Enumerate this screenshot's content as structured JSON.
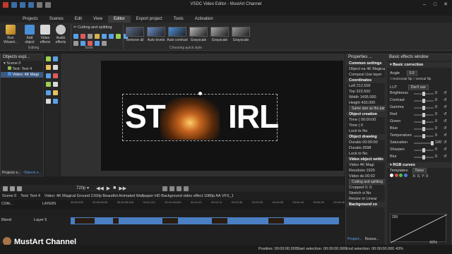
{
  "window": {
    "title": "VSDC Video Editor - MustArt Channel"
  },
  "menu": [
    "Projects",
    "Scenes",
    "Edit",
    "View",
    "Editor",
    "Export project",
    "Tools",
    "Activation"
  ],
  "menu_active_index": 4,
  "ribbon": {
    "run_wizard": "Run Wizard...",
    "add_object": "Add object",
    "video_effects": "Video effects",
    "audio_effects": "Audio effects",
    "editing_label": "Editing",
    "cutting": "Cutting and splitting",
    "tools_label": "Tools",
    "quick_styles": [
      "Remove all",
      "Auto levels",
      "Auto contrast",
      "Grayscale",
      "Grayscale",
      "Grayscale"
    ],
    "choosing_label": "Choosing quick style"
  },
  "explorer": {
    "title": "Objects expl...",
    "items": [
      "Scene 0",
      "Text: Text 4",
      "Video: 4K Magi"
    ],
    "tabs": [
      "Projects e...",
      "Objects e..."
    ]
  },
  "preview": {
    "text_left": "ST",
    "text_right": "IRL"
  },
  "properties": {
    "title": "Properties ...",
    "rows": [
      {
        "t": "Common settings",
        "s": true
      },
      {
        "t": "Object na 4K Magical",
        "s": false
      },
      {
        "t": "Composi Use layer",
        "s": false
      },
      {
        "t": "Coordinates",
        "s": true
      },
      {
        "t": "Left      212.500",
        "s": false
      },
      {
        "t": "Top       323.500",
        "s": false
      },
      {
        "t": "Width   1495.000",
        "s": false
      },
      {
        "t": "Height  433.000",
        "s": false
      },
      {
        "t": "Same size as the par",
        "s": false,
        "btn": true
      },
      {
        "t": "Object creation",
        "s": true
      },
      {
        "t": "Time ( 00:00:00",
        "s": false
      },
      {
        "t": "Time ( 0",
        "s": false
      },
      {
        "t": "Lock to No",
        "s": false
      },
      {
        "t": "Object drawing",
        "s": true
      },
      {
        "t": "Duratio 00:00:00",
        "s": false
      },
      {
        "t": "Duratio 3598",
        "s": false
      },
      {
        "t": "Lock to No",
        "s": false
      },
      {
        "t": "Video object settin",
        "s": true
      },
      {
        "t": "Video    4K Magi",
        "s": false
      },
      {
        "t": "Resolutio 1920",
        "s": false
      },
      {
        "t": "Video du 00:02",
        "s": false
      },
      {
        "t": "Cutting and splitting",
        "s": false,
        "btn": true
      },
      {
        "t": "Cropped  0; 0;",
        "s": false
      },
      {
        "t": "Stretch vi No",
        "s": false
      },
      {
        "t": "Resize m Linear",
        "s": false
      },
      {
        "t": "Background co",
        "s": true
      }
    ],
    "tabs": [
      "Propert...",
      "Resour..."
    ]
  },
  "effects": {
    "title": "Basic effects window",
    "section": "Basic correction",
    "angle_label": "Angle",
    "angle_value": "0.0",
    "h_flip": "Horizontal flip",
    "v_flip": "Vertical flip",
    "lut_label": "LUT",
    "lut_value": "Don't use",
    "sliders": [
      {
        "label": "Brightness",
        "value": "0"
      },
      {
        "label": "Contrast",
        "value": "0"
      },
      {
        "label": "Gamma",
        "value": "0"
      },
      {
        "label": "Red",
        "value": "0"
      },
      {
        "label": "Green",
        "value": "0"
      },
      {
        "label": "Blue",
        "value": "0"
      },
      {
        "label": "Temperature",
        "value": "0"
      },
      {
        "label": "Saturation",
        "value": "100"
      },
      {
        "label": "Sharpen",
        "value": "0"
      },
      {
        "label": "Blur",
        "value": "0"
      }
    ],
    "rgb_section": "RGB curves",
    "templates_label": "Templates:",
    "templates_value": "None",
    "curve_value": "255",
    "coords": "X: 0, Y: 0",
    "zoom": "43%"
  },
  "timeline": {
    "resolution": "720p",
    "breadcrumb": [
      "Scene 0",
      "Text: Text 4",
      "Video: 4K Magical Ground 2160p Beautiful Animated Wallpaper HD Background video effect 1080p AA VFX_1"
    ],
    "layers_header": "LAYERS",
    "com_label": "COM...",
    "blend_label": "Blend",
    "layer_label": "Layer 5",
    "ruler": [
      "00:00:000",
      "00:00:00:00",
      "00:00:35:400",
      "00:01:011",
      "00:01:06:600",
      "00:01:40",
      "00:02:11",
      "00:02:36",
      "00:03:33",
      "00:04:05",
      "00:04:40",
      "00:05:20",
      "00:05:36"
    ]
  },
  "status": {
    "position_label": "Position:",
    "position": "00:00:00.000",
    "start_label": "Start selection:",
    "start": "00:00:00.000",
    "end_label": "End selection:",
    "end": "00:00:00.000",
    "zoom": "43%"
  },
  "watermark": "MustArt Channel",
  "colors": {
    "accent": "#3c7fd6",
    "dark_bg": "#1e1e1e",
    "panel": "#252526"
  }
}
